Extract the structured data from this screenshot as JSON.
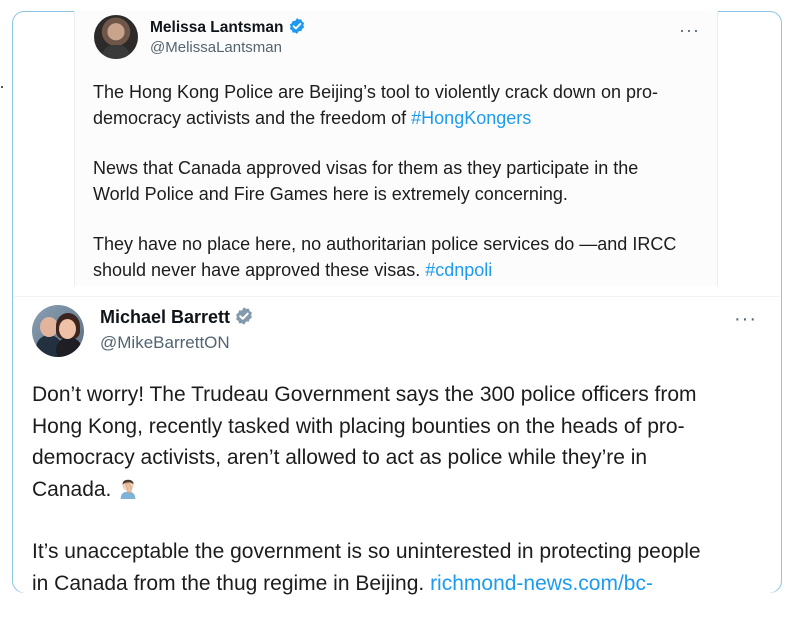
{
  "quoted_tweet": {
    "author_name": "Melissa Lantsman",
    "handle": "@MelissaLantsman",
    "more_label": "···",
    "paragraphs": [
      {
        "line1": "The Hong Kong Police are Beijing’s tool to violently crack down on pro-",
        "line2_prefix": "democracy activists and the freedom of ",
        "line2_hashtag": "#HongKongers"
      },
      {
        "line1": "News that Canada approved visas for them as they participate in the",
        "line2": "World Police and Fire Games here is extremely concerning."
      },
      {
        "line1": "They have no place here, no authoritarian police services do —and IRCC",
        "line2_prefix": "should never have approved these visas. ",
        "line2_hashtag": "#cdnpoli"
      }
    ]
  },
  "main_tweet": {
    "author_name": "Michael Barrett",
    "handle": "@MikeBarrettON",
    "more_label": "···",
    "paragraph1_lines": [
      "Don’t worry! The Trudeau Government says the 300 police officers from",
      "Hong Kong, recently tasked with placing bounties on the heads of pro-",
      "democracy activists, aren’t allowed to act as police while they’re in"
    ],
    "paragraph1_last": "Canada.",
    "emoji_name": "man-facepalming-icon",
    "paragraph2_line1": "It’s unacceptable the government is so uninterested in protecting people",
    "paragraph2_line2_prefix": "in Canada from the thug regime in Beijing. ",
    "paragraph2_link": "richmond-news.com/bc-"
  },
  "colors": {
    "link": "#1d9bf0",
    "verified_blue": "#1d9bf0",
    "verified_gray": "#829aab",
    "frame_border": "#8ec5e6",
    "secondary_text": "#536471"
  }
}
